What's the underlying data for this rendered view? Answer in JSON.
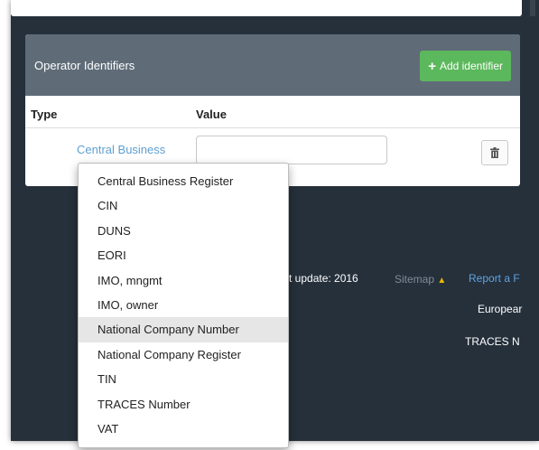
{
  "panel": {
    "title": "Operator Identifiers",
    "add_button_label": "Add identifier",
    "columns": {
      "type": "Type",
      "value": "Value"
    },
    "row": {
      "type_value": "Central Business",
      "value_input": ""
    }
  },
  "footer": {
    "last_update": "t update: 2016",
    "sitemap": "Sitemap",
    "report": "Report a F",
    "european": "Europear",
    "traces": "TRACES N"
  },
  "dropdown": {
    "options": [
      "Central Business Register",
      "CIN",
      "DUNS",
      "EORI",
      "IMO, mngmt",
      "IMO, owner",
      "National Company Number",
      "National Company Register",
      "TIN",
      "TRACES Number",
      "VAT"
    ],
    "highlighted": "National Company Number"
  },
  "colors": {
    "background": "#25303b",
    "panel_header": "#5f6c78",
    "add_button": "#5cb85c",
    "link": "#5f9fd0"
  },
  "icons": [
    "plus-icon",
    "trash-icon",
    "warning-icon"
  ]
}
